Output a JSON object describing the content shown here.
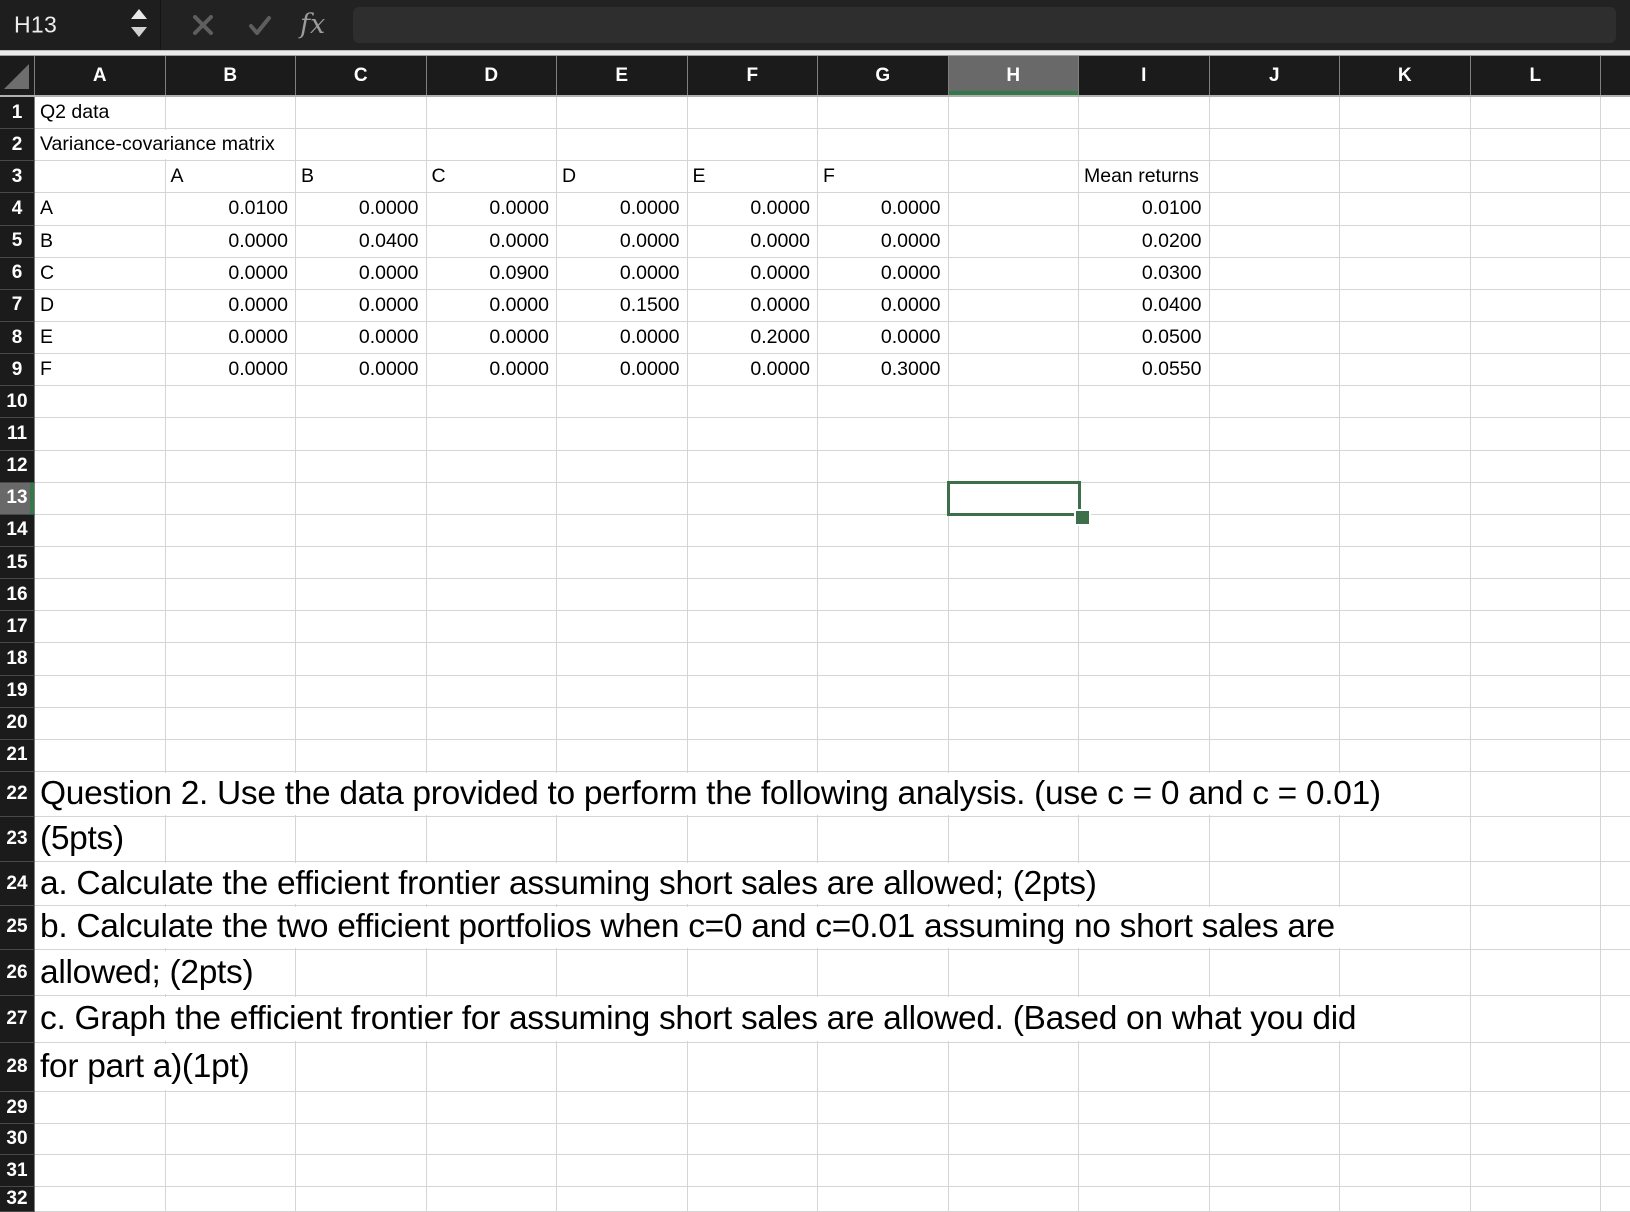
{
  "formula_bar": {
    "cell_reference": "H13",
    "formula_value": "",
    "fx_label": "fx"
  },
  "colors": {
    "selection_green": "#3e6f4b",
    "header_accent_green": "#35784a",
    "header_highlight_gray": "#696969",
    "header_bg": "#1b1b1b",
    "topbar_bg": "#222222",
    "gridline": "#d5d5d5"
  },
  "sheet": {
    "column_letters": [
      "A",
      "B",
      "C",
      "D",
      "E",
      "F",
      "G",
      "H",
      "I",
      "J",
      "K",
      "L"
    ],
    "visible_row_count": 32,
    "active_cell": {
      "ref": "H13",
      "col": "H",
      "row": 13
    },
    "rows": [
      {
        "n": 1,
        "cells": [
          {
            "col": "A",
            "value": "Q2 data",
            "align": "left",
            "overflow": true
          }
        ]
      },
      {
        "n": 2,
        "cells": [
          {
            "col": "A",
            "value": "Variance-covariance matrix",
            "align": "left",
            "overflow": true
          }
        ]
      },
      {
        "n": 3,
        "cells": [
          {
            "col": "B",
            "value": "A",
            "align": "left"
          },
          {
            "col": "C",
            "value": "B",
            "align": "left"
          },
          {
            "col": "D",
            "value": "C",
            "align": "left"
          },
          {
            "col": "E",
            "value": "D",
            "align": "left"
          },
          {
            "col": "F",
            "value": "E",
            "align": "left"
          },
          {
            "col": "G",
            "value": "F",
            "align": "left"
          },
          {
            "col": "I",
            "value": "Mean returns",
            "align": "left"
          }
        ]
      },
      {
        "n": 4,
        "cells": [
          {
            "col": "A",
            "value": "A",
            "align": "left"
          },
          {
            "col": "B",
            "value": "0.0100"
          },
          {
            "col": "C",
            "value": "0.0000"
          },
          {
            "col": "D",
            "value": "0.0000"
          },
          {
            "col": "E",
            "value": "0.0000"
          },
          {
            "col": "F",
            "value": "0.0000"
          },
          {
            "col": "G",
            "value": "0.0000"
          },
          {
            "col": "I",
            "value": "0.0100"
          }
        ]
      },
      {
        "n": 5,
        "cells": [
          {
            "col": "A",
            "value": "B",
            "align": "left"
          },
          {
            "col": "B",
            "value": "0.0000"
          },
          {
            "col": "C",
            "value": "0.0400"
          },
          {
            "col": "D",
            "value": "0.0000"
          },
          {
            "col": "E",
            "value": "0.0000"
          },
          {
            "col": "F",
            "value": "0.0000"
          },
          {
            "col": "G",
            "value": "0.0000"
          },
          {
            "col": "I",
            "value": "0.0200"
          }
        ]
      },
      {
        "n": 6,
        "cells": [
          {
            "col": "A",
            "value": "C",
            "align": "left"
          },
          {
            "col": "B",
            "value": "0.0000"
          },
          {
            "col": "C",
            "value": "0.0000"
          },
          {
            "col": "D",
            "value": "0.0900"
          },
          {
            "col": "E",
            "value": "0.0000"
          },
          {
            "col": "F",
            "value": "0.0000"
          },
          {
            "col": "G",
            "value": "0.0000"
          },
          {
            "col": "I",
            "value": "0.0300"
          }
        ]
      },
      {
        "n": 7,
        "cells": [
          {
            "col": "A",
            "value": "D",
            "align": "left"
          },
          {
            "col": "B",
            "value": "0.0000"
          },
          {
            "col": "C",
            "value": "0.0000"
          },
          {
            "col": "D",
            "value": "0.0000"
          },
          {
            "col": "E",
            "value": "0.1500"
          },
          {
            "col": "F",
            "value": "0.0000"
          },
          {
            "col": "G",
            "value": "0.0000"
          },
          {
            "col": "I",
            "value": "0.0400"
          }
        ]
      },
      {
        "n": 8,
        "cells": [
          {
            "col": "A",
            "value": "E",
            "align": "left"
          },
          {
            "col": "B",
            "value": "0.0000"
          },
          {
            "col": "C",
            "value": "0.0000"
          },
          {
            "col": "D",
            "value": "0.0000"
          },
          {
            "col": "E",
            "value": "0.0000"
          },
          {
            "col": "F",
            "value": "0.2000"
          },
          {
            "col": "G",
            "value": "0.0000"
          },
          {
            "col": "I",
            "value": "0.0500"
          }
        ]
      },
      {
        "n": 9,
        "cells": [
          {
            "col": "A",
            "value": "F",
            "align": "left"
          },
          {
            "col": "B",
            "value": "0.0000"
          },
          {
            "col": "C",
            "value": "0.0000"
          },
          {
            "col": "D",
            "value": "0.0000"
          },
          {
            "col": "E",
            "value": "0.0000"
          },
          {
            "col": "F",
            "value": "0.0000"
          },
          {
            "col": "G",
            "value": "0.3000"
          },
          {
            "col": "I",
            "value": "0.0550"
          }
        ]
      },
      {
        "n": 22,
        "big": true,
        "cells": [
          {
            "col": "A",
            "value": "Question 2. Use the data provided to perform the following analysis. (use c = 0 and c = 0.01)",
            "align": "left",
            "overflow": true
          }
        ]
      },
      {
        "n": 23,
        "big": true,
        "cells": [
          {
            "col": "A",
            "value": "(5pts)",
            "align": "left",
            "overflow": true
          }
        ]
      },
      {
        "n": 24,
        "big": true,
        "cells": [
          {
            "col": "A",
            "value": "a. Calculate the efficient frontier assuming short sales are allowed; (2pts)",
            "align": "left",
            "overflow": true
          }
        ]
      },
      {
        "n": 25,
        "big": true,
        "cells": [
          {
            "col": "A",
            "value": "b. Calculate the two efficient portfolios when c=0 and c=0.01 assuming no short sales are",
            "align": "left",
            "overflow": true
          }
        ]
      },
      {
        "n": 26,
        "big": true,
        "cells": [
          {
            "col": "A",
            "value": "allowed; (2pts)",
            "align": "left",
            "overflow": true
          }
        ]
      },
      {
        "n": 27,
        "big": true,
        "cells": [
          {
            "col": "A",
            "value": "c. Graph the efficient frontier for assuming short sales are allowed. (Based on what you did",
            "align": "left",
            "overflow": true
          }
        ]
      },
      {
        "n": 28,
        "big": true,
        "cells": [
          {
            "col": "A",
            "value": "for part a)(1pt)",
            "align": "left",
            "overflow": true
          }
        ]
      }
    ]
  }
}
